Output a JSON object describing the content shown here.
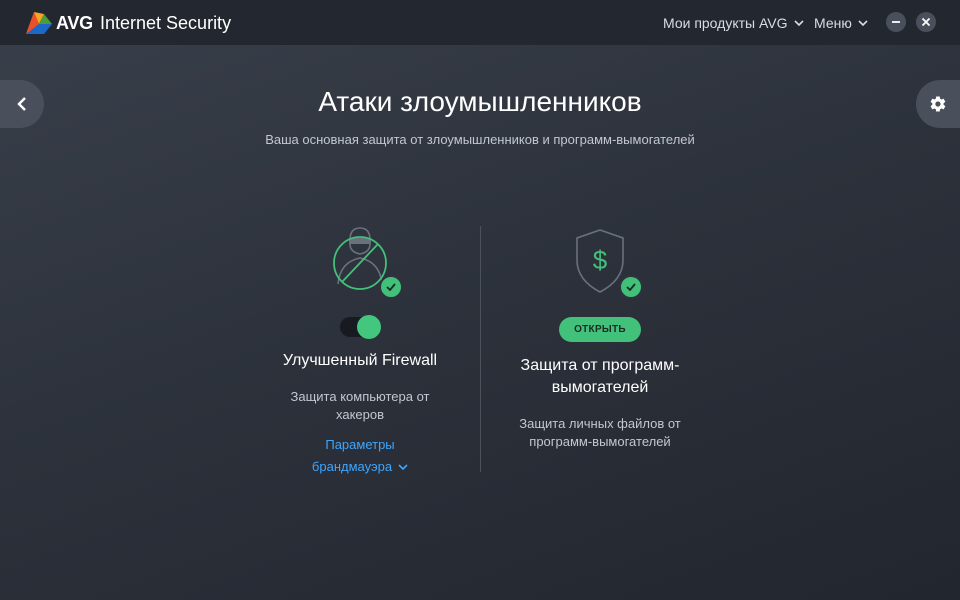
{
  "titlebar": {
    "brand": "AVG",
    "app_name": "Internet Security",
    "products_label": "Мои продукты AVG",
    "menu_label": "Меню"
  },
  "page": {
    "title": "Атаки злоумышленников",
    "subtitle": "Ваша основная защита от злоумышленников и программ-вымогателей"
  },
  "cards": {
    "firewall": {
      "title": "Улучшенный Firewall",
      "description": "Защита компьютера от хакеров",
      "toggle_on": true,
      "link_label": "Параметры брандмауэра",
      "status_icon": "check-icon"
    },
    "ransomware": {
      "title": "Защита от программ-вымогателей",
      "description": "Защита личных файлов от программ-вымогателей",
      "button_label": "ОТКРЫТЬ",
      "status_icon": "check-icon"
    }
  },
  "colors": {
    "accent_green": "#42c17b",
    "link_blue": "#3fa6ff",
    "titlebar_bg": "#23272f",
    "window_bg": "#2d323c"
  },
  "icons": {
    "logo": "avg-logo-icon",
    "back": "chevron-left-icon",
    "settings": "gear-icon",
    "minimize": "minimize-icon",
    "close": "close-icon",
    "firewall": "hacker-blocked-icon",
    "ransomware": "shield-dollar-icon"
  }
}
